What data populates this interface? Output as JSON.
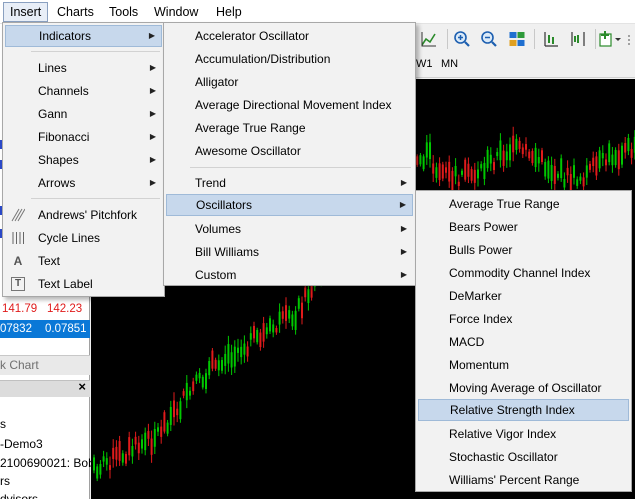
{
  "menubar": {
    "insert": "Insert",
    "charts": "Charts",
    "tools": "Tools",
    "window": "Window",
    "help": "Help"
  },
  "timeframes": [
    "W1",
    "MN"
  ],
  "quotes": [
    {
      "bid": "141.79",
      "ask": "142.23"
    },
    {
      "bid": "07832",
      "ask": "0.07851"
    }
  ],
  "chart_tab": "k Chart",
  "navigator": {
    "close": "×",
    "items": [
      "s",
      "-Demo3",
      "2100690021: Bob",
      "rs",
      "dvisors"
    ]
  },
  "insert_menu": {
    "items": [
      {
        "label": "Indicators",
        "submenu": true
      },
      {
        "label": "Lines",
        "submenu": true
      },
      {
        "label": "Channels",
        "submenu": true
      },
      {
        "label": "Gann",
        "submenu": true
      },
      {
        "label": "Fibonacci",
        "submenu": true
      },
      {
        "label": "Shapes",
        "submenu": true
      },
      {
        "label": "Arrows",
        "submenu": true
      },
      {
        "label": "Andrews' Pitchfork",
        "icon": "pitchfork-icon"
      },
      {
        "label": "Cycle Lines",
        "icon": "cycle-lines-icon"
      },
      {
        "label": "Text",
        "icon": "text-icon",
        "glyph": "A"
      },
      {
        "label": "Text Label",
        "icon": "text-label-icon",
        "glyph": "T"
      }
    ]
  },
  "indicators_menu": {
    "items": [
      {
        "label": "Accelerator Oscillator"
      },
      {
        "label": "Accumulation/Distribution"
      },
      {
        "label": "Alligator"
      },
      {
        "label": "Average Directional Movement Index"
      },
      {
        "label": "Average True Range"
      },
      {
        "label": "Awesome Oscillator"
      },
      {
        "label": "Trend",
        "submenu": true
      },
      {
        "label": "Oscillators",
        "submenu": true
      },
      {
        "label": "Volumes",
        "submenu": true
      },
      {
        "label": "Bill Williams",
        "submenu": true
      },
      {
        "label": "Custom",
        "submenu": true
      }
    ]
  },
  "oscillators_menu": {
    "items": [
      "Average True Range",
      "Bears Power",
      "Bulls Power",
      "Commodity Channel Index",
      "DeMarker",
      "Force Index",
      "MACD",
      "Momentum",
      "Moving Average of Oscillator",
      "Relative Strength Index",
      "Relative Vigor Index",
      "Stochastic Oscillator",
      "Williams' Percent Range"
    ],
    "highlighted": "Relative Strength Index"
  },
  "colors": {
    "menu_highlight": "#c7d8ec",
    "chart_background": "#000000",
    "bull_candle": "#00c800",
    "bear_candle": "#e01b1b",
    "selected_quote_row": "#0a78d7"
  }
}
